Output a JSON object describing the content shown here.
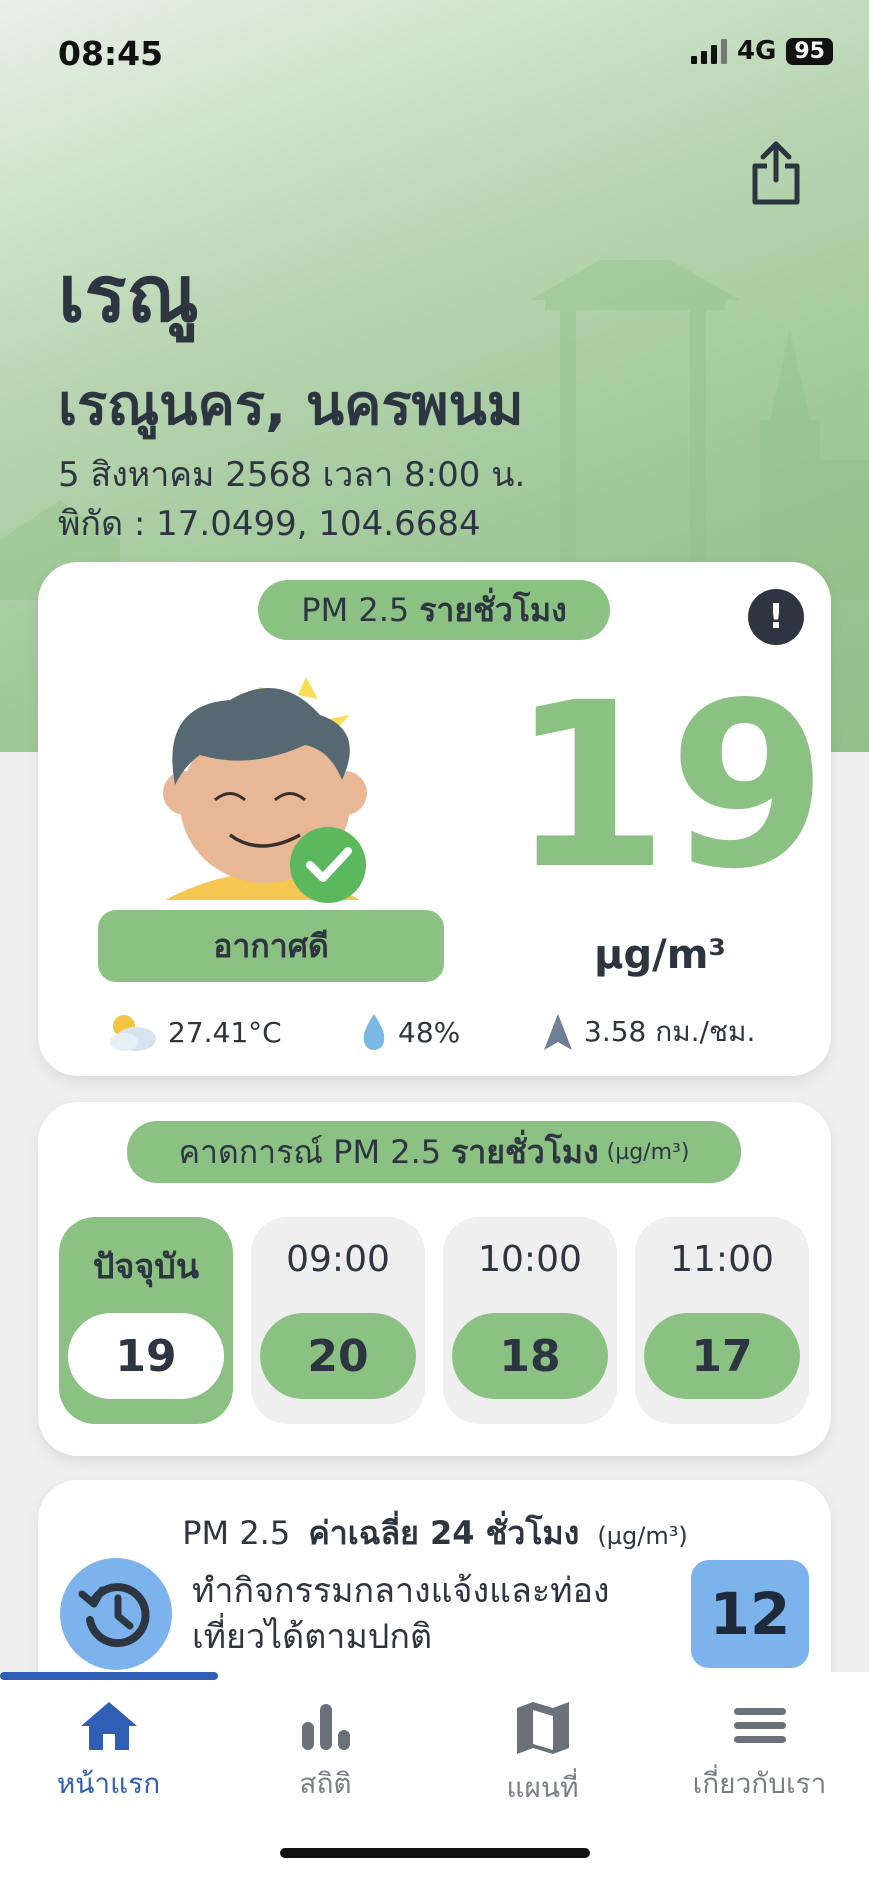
{
  "status_bar": {
    "time": "08:45",
    "network": "4G",
    "battery": "95"
  },
  "header": {
    "title": "เรณู",
    "subtitle": "เรณูนคร, นครพนม",
    "date_time": "5 สิงหาคม 2568  เวลา 8:00 น.",
    "coordinates": "พิกัด : 17.0499, 104.6684"
  },
  "current": {
    "pill_prefix": "PM 2.5",
    "pill_bold": "รายชั่วโมง",
    "info_label": "!",
    "status": "อากาศดี",
    "pm_value": "19",
    "unit": "µg/m³",
    "temperature": "27.41°C",
    "humidity": "48%",
    "wind": "3.58 กม./ชม.",
    "accent_color": "#8bc283"
  },
  "forecast": {
    "pill_prefix": "คาดการณ์ PM 2.5",
    "pill_bold": "รายชั่วโมง",
    "pill_unit": "(µg/m³)",
    "items": [
      {
        "time": "ปัจจุบัน",
        "value": "19"
      },
      {
        "time": "09:00",
        "value": "20"
      },
      {
        "time": "10:00",
        "value": "18"
      },
      {
        "time": "11:00",
        "value": "17"
      }
    ]
  },
  "average": {
    "title_prefix": "PM 2.5",
    "title_bold": "ค่าเฉลี่ย 24 ชั่วโมง",
    "title_unit": "(µg/m³)",
    "advice_line1": "ทำกิจกรรมกลางแจ้งและท่อง",
    "advice_line2": "เที่ยวได้ตามปกติ",
    "value": "12",
    "accent_color": "#7db3ec"
  },
  "tabs": [
    {
      "label": "หน้าแรก",
      "icon": "home-icon",
      "active": true
    },
    {
      "label": "สถิติ",
      "icon": "bar-chart-icon",
      "active": false
    },
    {
      "label": "แผนที่",
      "icon": "map-icon",
      "active": false
    },
    {
      "label": "เกี่ยวกับเรา",
      "icon": "menu-icon",
      "active": false
    }
  ]
}
